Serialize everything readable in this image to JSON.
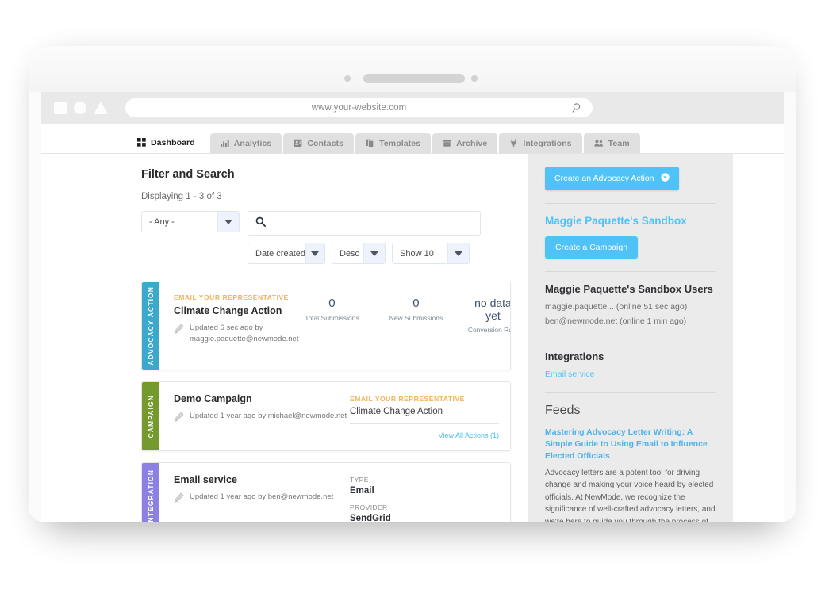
{
  "browser": {
    "url": "www.your-website.com",
    "search_icon": "magnifier-icon",
    "shapes": [
      "square",
      "circle",
      "triangle"
    ]
  },
  "tabs": [
    {
      "label": "Dashboard",
      "icon": "grid-icon",
      "active": true
    },
    {
      "label": "Analytics",
      "icon": "bar-chart-icon",
      "active": false
    },
    {
      "label": "Contacts",
      "icon": "id-card-icon",
      "active": false
    },
    {
      "label": "Templates",
      "icon": "copy-icon",
      "active": false
    },
    {
      "label": "Archive",
      "icon": "archive-icon",
      "active": false
    },
    {
      "label": "Integrations",
      "icon": "plug-icon",
      "active": false
    },
    {
      "label": "Team",
      "icon": "people-icon",
      "active": false
    }
  ],
  "main": {
    "section_title": "Filter and Search",
    "displaying": "Displaying 1 - 3 of 3",
    "filters": {
      "type_select": {
        "value": "- Any -"
      },
      "search": {
        "value": "",
        "placeholder": "",
        "icon": "search-icon"
      },
      "sort_field": {
        "value": "Date created"
      },
      "sort_direction": {
        "value": "Desc"
      },
      "page_size": {
        "value": "Show 10"
      }
    },
    "cards": [
      {
        "stripe_label": "ADVOCACY ACTION",
        "stripe_color": "#3ba8cc",
        "eyebrow": "EMAIL YOUR REPRESENTATIVE",
        "title": "Climate Change Action",
        "meta_line1": "Updated 6 sec ago by",
        "meta_line2": "maggie.paquette@newmode.net",
        "stats": [
          {
            "value": "0",
            "label": "Total Submissions"
          },
          {
            "value": "0",
            "label": "New Submissions"
          },
          {
            "value": "no data yet",
            "label": "Conversion Rate"
          }
        ]
      },
      {
        "stripe_label": "CAMPAIGN",
        "stripe_color": "#74992d",
        "title": "Demo Campaign",
        "meta_line1": "Updated 1 year ago by michael@newmode.net",
        "right_eyebrow": "EMAIL YOUR REPRESENTATIVE",
        "right_action": "Climate Change Action",
        "view_all": "View All Actions (1)"
      },
      {
        "stripe_label": "INTEGRATION",
        "stripe_color": "#8b81e3",
        "title": "Email service",
        "meta_line1": "Updated 1 year ago by ben@newmode.net",
        "details": [
          {
            "key": "TYPE",
            "value": "Email"
          },
          {
            "key": "PROVIDER",
            "value": "SendGrid"
          }
        ]
      }
    ]
  },
  "sidebar": {
    "create_action_button": "Create an Advocacy Action",
    "create_action_icon": "chevron-down-circle-icon",
    "org_title": "Maggie Paquette's Sandbox",
    "create_campaign_button": "Create a Campaign",
    "users_title": "Maggie Paquette's Sandbox Users",
    "users": [
      "maggie.paquette... (online 51 sec ago)",
      "ben@newmode.net (online 1 min ago)"
    ],
    "integrations_title": "Integrations",
    "integrations": [
      "Email service"
    ],
    "feeds_title": "Feeds",
    "feed_item": {
      "title": "Mastering Advocacy Letter Writing: A Simple Guide to Using Email to Influence Elected Officials",
      "body": "Advocacy letters are a potent tool for driving change and making your voice heard by elected officials. At NewMode, we recognize the significance of well-crafted advocacy letters, and we're here to guide you through the process of writing an impactful letter that can make a real difference. Let's delve into the key steps and best"
    }
  },
  "colors": {
    "accent_blue": "#4fc3f7",
    "eyebrow_orange": "#f0b25c",
    "advocacy": "#3ba8cc",
    "campaign": "#74992d",
    "integration": "#8b81e3"
  }
}
